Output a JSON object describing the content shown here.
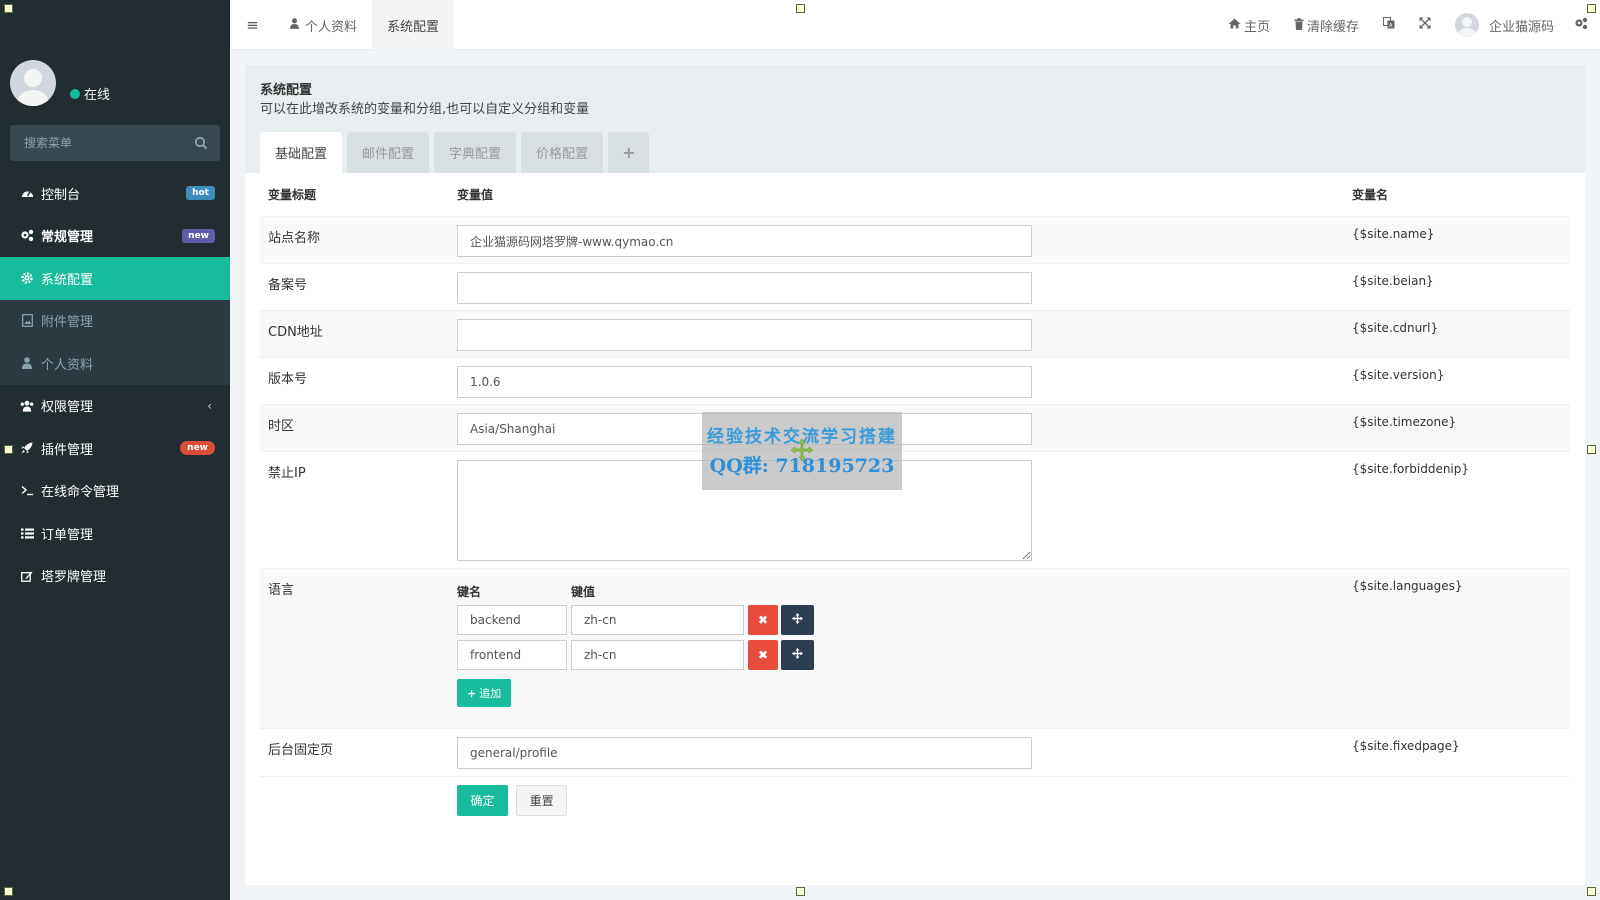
{
  "sidebar": {
    "status": "在线",
    "search_placeholder": "搜索菜单",
    "items": [
      {
        "label": "控制台",
        "icon": "dashboard-icon",
        "badge": "hot"
      },
      {
        "label": "常规管理",
        "icon": "cogs-icon",
        "badge": "new"
      },
      {
        "label": "系统配置",
        "icon": "gear-icon"
      },
      {
        "label": "附件管理",
        "icon": "file-image-icon"
      },
      {
        "label": "个人资料",
        "icon": "user-icon"
      },
      {
        "label": "权限管理",
        "icon": "group-icon"
      },
      {
        "label": "插件管理",
        "icon": "rocket-icon",
        "badge": "new"
      },
      {
        "label": "在线命令管理",
        "icon": "terminal-icon"
      },
      {
        "label": "订单管理",
        "icon": "list-icon"
      },
      {
        "label": "塔罗牌管理",
        "icon": "pencil-square-icon"
      }
    ]
  },
  "navbar": {
    "tabs": [
      {
        "label": "个人资料",
        "icon": "user-icon"
      },
      {
        "label": "系统配置"
      }
    ],
    "home": "主页",
    "clear_cache": "清除缓存",
    "username": "企业猫源码"
  },
  "panel": {
    "title": "系统配置",
    "description": "可以在此增改系统的变量和分组,也可以自定义分组和变量",
    "tabs": [
      "基础配置",
      "邮件配置",
      "字典配置",
      "价格配置",
      "+"
    ]
  },
  "table": {
    "headers": [
      "变量标题",
      "变量值",
      "变量名"
    ],
    "rows": [
      {
        "title": "站点名称",
        "value": "企业猫源码网塔罗牌-www.qymao.cn",
        "name": "{$site.name}"
      },
      {
        "title": "备案号",
        "value": "",
        "name": "{$site.beian}"
      },
      {
        "title": "CDN地址",
        "value": "",
        "name": "{$site.cdnurl}"
      },
      {
        "title": "版本号",
        "value": "1.0.6",
        "name": "{$site.version}"
      },
      {
        "title": "时区",
        "value": "Asia/Shanghai",
        "name": "{$site.timezone}"
      },
      {
        "title": "禁止IP",
        "value": "",
        "name": "{$site.forbiddenip}"
      },
      {
        "title": "语言",
        "name": "{$site.languages}"
      },
      {
        "title": "后台固定页",
        "value": "general/profile",
        "name": "{$site.fixedpage}"
      }
    ],
    "languages": {
      "key_header": "键名",
      "value_header": "键值",
      "pairs": [
        {
          "key": "backend",
          "value": "zh-cn"
        },
        {
          "key": "frontend",
          "value": "zh-cn"
        }
      ],
      "add_label": "追加"
    }
  },
  "buttons": {
    "submit": "确定",
    "reset": "重置"
  },
  "watermark": {
    "line1": "经验技术交流学习搭建",
    "line2": "QQ群: 718195723"
  },
  "colors": {
    "accent": "#18bc9c",
    "sidebar": "#222d32",
    "danger": "#e74c3c",
    "dark": "#2c3e50"
  }
}
